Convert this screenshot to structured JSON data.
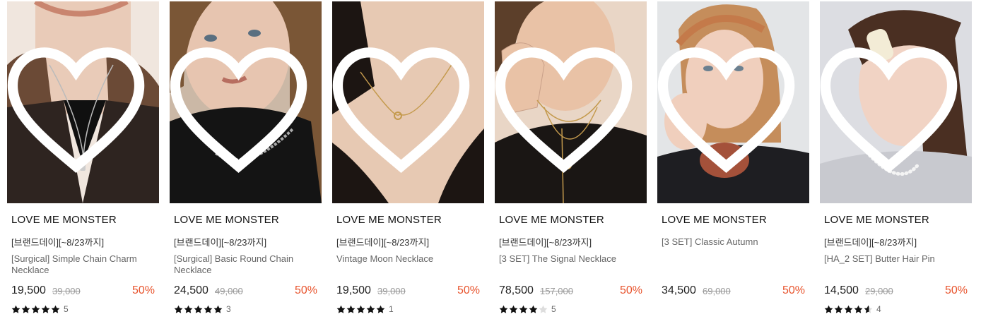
{
  "products": [
    {
      "brand": "LOVE ME MONSTER",
      "promo": "[브랜드데이][~8/23까지]",
      "name": "[Surgical] Simple Chain Charm Necklace",
      "price": "19,500",
      "original_price": "39,000",
      "discount": "50%",
      "rating": 5,
      "review_count": "5",
      "photo_tone": "#d9cfc6",
      "accent": "#3a2a22"
    },
    {
      "brand": "LOVE ME MONSTER",
      "promo": "[브랜드데이][~8/23까지]",
      "name": "[Surgical] Basic Round Chain Necklace",
      "price": "24,500",
      "original_price": "49,000",
      "discount": "50%",
      "rating": 5,
      "review_count": "3",
      "photo_tone": "#c9b8aa",
      "accent": "#141414"
    },
    {
      "brand": "LOVE ME MONSTER",
      "promo": "[브랜드데이][~8/23까지]",
      "name": "Vintage Moon Necklace",
      "price": "19,500",
      "original_price": "39,000",
      "discount": "50%",
      "rating": 5,
      "review_count": "1",
      "photo_tone": "#e3c4ad",
      "accent": "#1c1512"
    },
    {
      "brand": "LOVE ME MONSTER",
      "promo": "[브랜드데이][~8/23까지]",
      "name": "[3 SET] The Signal Necklace",
      "price": "78,500",
      "original_price": "157,000",
      "discount": "50%",
      "rating": 4,
      "review_count": "5",
      "photo_tone": "#e6d0bf",
      "accent": "#1a1614"
    },
    {
      "brand": "LOVE ME MONSTER",
      "promo": "",
      "name": "[3 SET] Classic Autumn",
      "price": "34,500",
      "original_price": "69,000",
      "discount": "50%",
      "rating": 0,
      "review_count": "",
      "photo_tone": "#dfe1e3",
      "accent": "#1e1e22"
    },
    {
      "brand": "LOVE ME MONSTER",
      "promo": "[브랜드데이][~8/23까지]",
      "name": "[HA_2 SET] Butter Hair Pin",
      "price": "14,500",
      "original_price": "29,000",
      "discount": "50%",
      "rating": 4.5,
      "review_count": "4",
      "photo_tone": "#dddee3",
      "accent": "#c8c9cf"
    }
  ],
  "colors": {
    "discount": "#e8542d",
    "star": "#111111",
    "heart_outline": "#ffffff"
  },
  "icons": {
    "wishlist": "heart-outline-icon",
    "rating": "star-icon"
  }
}
